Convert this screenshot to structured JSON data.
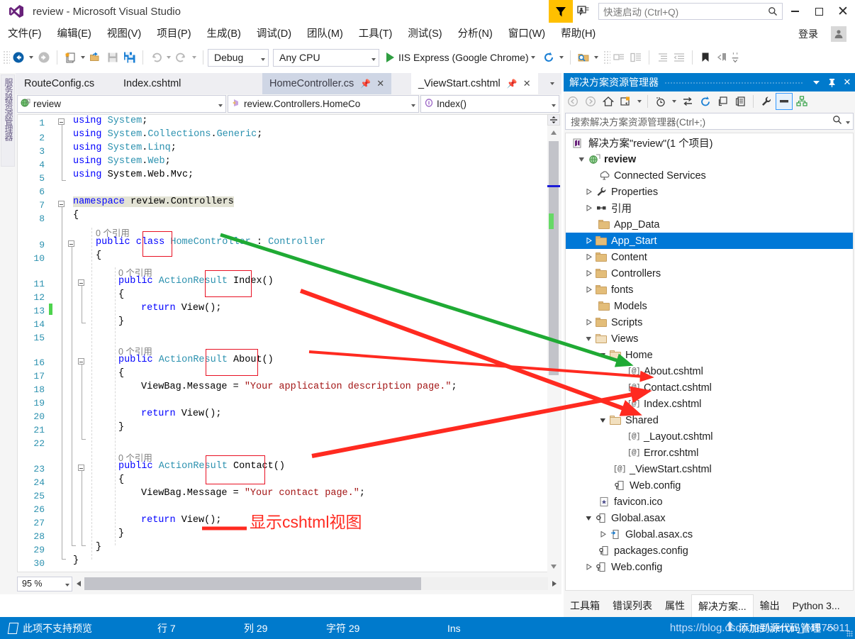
{
  "titlebar": {
    "title": "review - Microsoft Visual Studio",
    "logo_icon": "visual-studio-logo-icon",
    "feedback_icon": "feedback-filter-icon",
    "feedback_send_icon": "send-feedback-icon",
    "quick_launch_placeholder": "快速启动 (Ctrl+Q)",
    "search_icon": "search-icon",
    "minimize_icon": "minimize-icon",
    "maximize_icon": "maximize-icon",
    "close_icon": "close-icon"
  },
  "menubar": {
    "items": [
      {
        "label": "文件(F)",
        "accel": "F"
      },
      {
        "label": "编辑(E)",
        "accel": "E"
      },
      {
        "label": "视图(V)",
        "accel": "V"
      },
      {
        "label": "项目(P)",
        "accel": "P"
      },
      {
        "label": "生成(B)",
        "accel": "B"
      },
      {
        "label": "调试(D)",
        "accel": "D"
      },
      {
        "label": "团队(M)",
        "accel": "M"
      },
      {
        "label": "工具(T)",
        "accel": "T"
      },
      {
        "label": "测试(S)",
        "accel": "S"
      },
      {
        "label": "分析(N)",
        "accel": "N"
      },
      {
        "label": "窗口(W)",
        "accel": "W"
      },
      {
        "label": "帮助(H)",
        "accel": "H"
      }
    ],
    "signin_label": "登录",
    "account_icon": "account-icon"
  },
  "toolbar": {
    "nav_back_icon": "navigate-back-icon",
    "nav_forward_icon": "navigate-forward-icon",
    "new_project_icon": "new-project-icon",
    "open_file_icon": "open-file-icon",
    "save_icon": "save-icon",
    "save_all_icon": "save-all-icon",
    "undo_icon": "undo-icon",
    "redo_icon": "redo-icon",
    "config_value": "Debug",
    "platform_value": "Any CPU",
    "run_label": "IIS Express (Google Chrome)",
    "play_icon": "play-icon",
    "refresh_icon": "refresh-icon",
    "find_icon": "find-in-files-icon",
    "comment_icon": "comment-icon",
    "uncomment_icon": "uncomment-icon",
    "indent_icon": "increase-indent-icon",
    "outdent_icon": "decrease-indent-icon",
    "bookmark_icon": "bookmark-icon",
    "prev_bookmark_icon": "previous-bookmark-icon",
    "next_bookmark_icon": "next-bookmark-icon"
  },
  "left_dock": {
    "label": "服务器资源管理器"
  },
  "editor": {
    "tabs": [
      {
        "label": "RouteConfig.cs",
        "state": "inactive",
        "closable": false
      },
      {
        "label": "Index.cshtml",
        "state": "inactive",
        "closable": false
      },
      {
        "label": "HomeController.cs",
        "state": "active",
        "pin_icon": "pin-icon",
        "close_icon": "close-icon"
      },
      {
        "label": "_ViewStart.cshtml",
        "state": "selected",
        "pin_icon": "pin-icon",
        "close_icon": "close-icon"
      }
    ],
    "tab_overflow_icon": "chevron-down-icon",
    "nav": {
      "project": "review",
      "project_icon": "web-project-icon",
      "type": "review.Controllers.HomeCo",
      "type_icon": "class-icon",
      "member": "Index()",
      "member_icon": "method-icon"
    },
    "zoom_level": "95 %",
    "split_icon": "split-view-icon",
    "scroll_up_icon": "scroll-up-icon",
    "scroll_down_icon": "scroll-down-icon",
    "scroll_left_icon": "scroll-left-icon",
    "scroll_right_icon": "scroll-right-icon",
    "lines": [
      {
        "n": 1,
        "text": "using System;"
      },
      {
        "n": 2,
        "text": "using System.Collections.Generic;"
      },
      {
        "n": 3,
        "text": "using System.Linq;"
      },
      {
        "n": 4,
        "text": "using System.Web;"
      },
      {
        "n": 5,
        "text": "using System.Web.Mvc;"
      },
      {
        "n": 6,
        "text": ""
      },
      {
        "n": 7,
        "text": "namespace review.Controllers"
      },
      {
        "n": 8,
        "text": "{"
      },
      {
        "n": 9,
        "text": "    public class HomeController : Controller"
      },
      {
        "n": 10,
        "text": "    {"
      },
      {
        "n": 11,
        "text": "        public ActionResult Index()"
      },
      {
        "n": 12,
        "text": "        {"
      },
      {
        "n": 13,
        "text": "            return View();"
      },
      {
        "n": 14,
        "text": "        }"
      },
      {
        "n": 15,
        "text": ""
      },
      {
        "n": 16,
        "text": "        public ActionResult About()"
      },
      {
        "n": 17,
        "text": "        {"
      },
      {
        "n": 18,
        "text": "            ViewBag.Message = \"Your application description page.\";"
      },
      {
        "n": 19,
        "text": ""
      },
      {
        "n": 20,
        "text": "            return View();"
      },
      {
        "n": 21,
        "text": "        }"
      },
      {
        "n": 22,
        "text": ""
      },
      {
        "n": 23,
        "text": "        public ActionResult Contact()"
      },
      {
        "n": 24,
        "text": "        {"
      },
      {
        "n": 25,
        "text": "            ViewBag.Message = \"Your contact page.\";"
      },
      {
        "n": 26,
        "text": ""
      },
      {
        "n": 27,
        "text": "            return View();"
      },
      {
        "n": 28,
        "text": "        }"
      },
      {
        "n": 29,
        "text": "    }"
      },
      {
        "n": 30,
        "text": "}"
      }
    ],
    "codelens": "0 个引用"
  },
  "solution_explorer": {
    "title": "解决方案资源管理器",
    "dropdown_icon": "chevron-down-icon",
    "pin_icon": "pin-icon",
    "close_icon": "close-icon",
    "toolbar_icons": [
      "back-icon",
      "forward-icon",
      "home-icon",
      "new-folder-icon",
      "chevron-down-icon",
      "pending-changes-icon",
      "chevron-down-icon",
      "sync-with-active-document-icon",
      "refresh-icon",
      "collapse-all-icon",
      "show-all-files-icon",
      "properties-icon",
      "preview-selected-items-icon",
      "class-view-icon"
    ],
    "search_placeholder": "搜索解决方案资源管理器(Ctrl+;)",
    "search_icon": "search-icon",
    "tree": [
      {
        "depth": 0,
        "label": "解决方案\"review\"(1 个项目)",
        "icon": "solution-icon",
        "twisty": "none",
        "bold": false,
        "selected": false
      },
      {
        "depth": 1,
        "label": "review",
        "icon": "web-project-icon",
        "twisty": "expanded",
        "bold": true,
        "selected": false
      },
      {
        "depth": 2,
        "label": "Connected Services",
        "icon": "connected-services-icon",
        "twisty": "none",
        "bold": false,
        "selected": false
      },
      {
        "depth": 2,
        "label": "Properties",
        "icon": "properties-wrench-icon",
        "twisty": "collapsed",
        "bold": false,
        "selected": false
      },
      {
        "depth": 2,
        "label": "引用",
        "icon": "references-icon",
        "twisty": "collapsed",
        "bold": false,
        "selected": false
      },
      {
        "depth": 2,
        "label": "App_Data",
        "icon": "folder-icon",
        "twisty": "none",
        "bold": false,
        "selected": false
      },
      {
        "depth": 2,
        "label": "App_Start",
        "icon": "folder-icon",
        "twisty": "collapsed",
        "bold": false,
        "selected": true
      },
      {
        "depth": 2,
        "label": "Content",
        "icon": "folder-icon",
        "twisty": "collapsed",
        "bold": false,
        "selected": false
      },
      {
        "depth": 2,
        "label": "Controllers",
        "icon": "folder-icon",
        "twisty": "collapsed",
        "bold": false,
        "selected": false
      },
      {
        "depth": 2,
        "label": "fonts",
        "icon": "folder-icon",
        "twisty": "collapsed",
        "bold": false,
        "selected": false
      },
      {
        "depth": 2,
        "label": "Models",
        "icon": "folder-icon",
        "twisty": "none",
        "bold": false,
        "selected": false
      },
      {
        "depth": 2,
        "label": "Scripts",
        "icon": "folder-icon",
        "twisty": "collapsed",
        "bold": false,
        "selected": false
      },
      {
        "depth": 2,
        "label": "Views",
        "icon": "folder-open-icon",
        "twisty": "expanded",
        "bold": false,
        "selected": false
      },
      {
        "depth": 3,
        "label": "Home",
        "icon": "folder-open-icon",
        "twisty": "expanded",
        "bold": false,
        "selected": false
      },
      {
        "depth": 4,
        "label": "About.cshtml",
        "icon": "razor-view-icon",
        "twisty": "none",
        "bold": false,
        "selected": false
      },
      {
        "depth": 4,
        "label": "Contact.cshtml",
        "icon": "razor-view-icon",
        "twisty": "none",
        "bold": false,
        "selected": false
      },
      {
        "depth": 4,
        "label": "Index.cshtml",
        "icon": "razor-view-icon",
        "twisty": "none",
        "bold": false,
        "selected": false
      },
      {
        "depth": 3,
        "label": "Shared",
        "icon": "folder-open-icon",
        "twisty": "expanded",
        "bold": false,
        "selected": false
      },
      {
        "depth": 4,
        "label": "_Layout.cshtml",
        "icon": "razor-view-icon",
        "twisty": "none",
        "bold": false,
        "selected": false
      },
      {
        "depth": 4,
        "label": "Error.cshtml",
        "icon": "razor-view-icon",
        "twisty": "none",
        "bold": false,
        "selected": false
      },
      {
        "depth": 3,
        "label": "_ViewStart.cshtml",
        "icon": "razor-view-icon",
        "twisty": "none",
        "bold": false,
        "selected": false
      },
      {
        "depth": 3,
        "label": "Web.config",
        "icon": "config-file-icon",
        "twisty": "none",
        "bold": false,
        "selected": false
      },
      {
        "depth": 2,
        "label": "favicon.ico",
        "icon": "image-file-icon",
        "twisty": "none",
        "bold": false,
        "selected": false
      },
      {
        "depth": 2,
        "label": "Global.asax",
        "icon": "global-asax-icon",
        "twisty": "expanded",
        "bold": false,
        "selected": false
      },
      {
        "depth": 3,
        "label": "Global.asax.cs",
        "icon": "csharp-file-icon",
        "twisty": "collapsed",
        "bold": false,
        "selected": false
      },
      {
        "depth": 2,
        "label": "packages.config",
        "icon": "config-file-icon",
        "twisty": "none",
        "bold": false,
        "selected": false
      },
      {
        "depth": 2,
        "label": "Web.config",
        "icon": "config-file-icon",
        "twisty": "collapsed",
        "bold": false,
        "selected": false
      }
    ]
  },
  "bottom_dock": {
    "tabs": [
      {
        "label": "工具箱",
        "active": false
      },
      {
        "label": "错误列表",
        "active": false
      },
      {
        "label": "属性",
        "active": false
      },
      {
        "label": "解决方案...",
        "active": true
      },
      {
        "label": "输出",
        "active": false
      },
      {
        "label": "Python 3...",
        "active": false
      }
    ]
  },
  "statusbar": {
    "preview_icon": "no-preview-icon",
    "message": "此项不支持预览",
    "line": "行 7",
    "column": "列 29",
    "char": "字符 29",
    "insert_mode": "Ins",
    "source_control_label": "添加到源代码管理",
    "source_control_icon": "add-to-source-control-icon",
    "watermark": "https://blog.csdn.net/weixin_44575911"
  },
  "annotations": {
    "note_text": "显示cshtml视图",
    "red_color": "#ff2a20",
    "green_color": "#1faa34",
    "boxes": [
      "HomeController",
      "Index()",
      "About()",
      "Contact()"
    ],
    "green_arrow": {
      "from": "HomeController",
      "to": "Views/Home folder"
    },
    "red_arrows": [
      {
        "from": "Index()",
        "to": "Index.cshtml"
      },
      {
        "from": "About()",
        "to": "About.cshtml"
      },
      {
        "from": "Contact()",
        "to": "Contact.cshtml"
      }
    ]
  }
}
